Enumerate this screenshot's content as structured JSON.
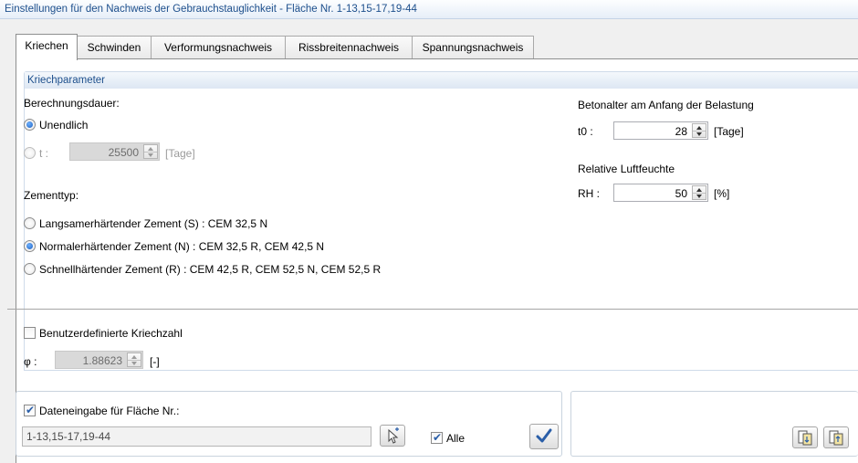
{
  "window": {
    "title": "Einstellungen für den Nachweis der Gebrauchstauglichkeit - Fläche Nr. 1-13,15-17,19-44"
  },
  "tabs": [
    {
      "label": "Kriechen",
      "active": true
    },
    {
      "label": "Schwinden"
    },
    {
      "label": "Verformungsnachweis"
    },
    {
      "label": "Rissbreitennachweis"
    },
    {
      "label": "Spannungsnachweis"
    }
  ],
  "group": {
    "title": "Kriechparameter"
  },
  "duration": {
    "label": "Berechnungsdauer:",
    "infinite_label": "Unendlich",
    "t_label": "t :",
    "t_value": "25500",
    "t_unit": "[Tage]"
  },
  "age": {
    "label": "Betonalter am Anfang der Belastung",
    "symbol": "t0 :",
    "value": "28",
    "unit": "[Tage]"
  },
  "humidity": {
    "label": "Relative Luftfeuchte",
    "symbol": "RH :",
    "value": "50",
    "unit": "[%]"
  },
  "cement": {
    "label": "Zementtyp:",
    "options": [
      "Langsamerhärtender Zement (S) : CEM 32,5 N",
      "Normalerhärtender Zement (N) : CEM 32,5 R, CEM 42,5 N",
      "Schnellhärtender Zement (R) : CEM 42,5 R, CEM 52,5 N, CEM 52,5 R"
    ],
    "selected": 1
  },
  "creep": {
    "checkbox_label": "Benutzerdefinierte Kriechzahl",
    "symbol": "φ :",
    "value": "1.88623",
    "unit": "[-]"
  },
  "data_input": {
    "checkbox_label": "Dateneingabe für Fläche Nr.:",
    "surfaces": "1-13,15-17,19-44",
    "all_label": "Alle"
  },
  "icons": {
    "pick": "pick-surface-icon",
    "apply": "checkmark-icon",
    "import": "import-icon",
    "export": "export-icon"
  },
  "colors": {
    "title_text": "#1d4f8c",
    "accent": "#2a5ea8"
  }
}
